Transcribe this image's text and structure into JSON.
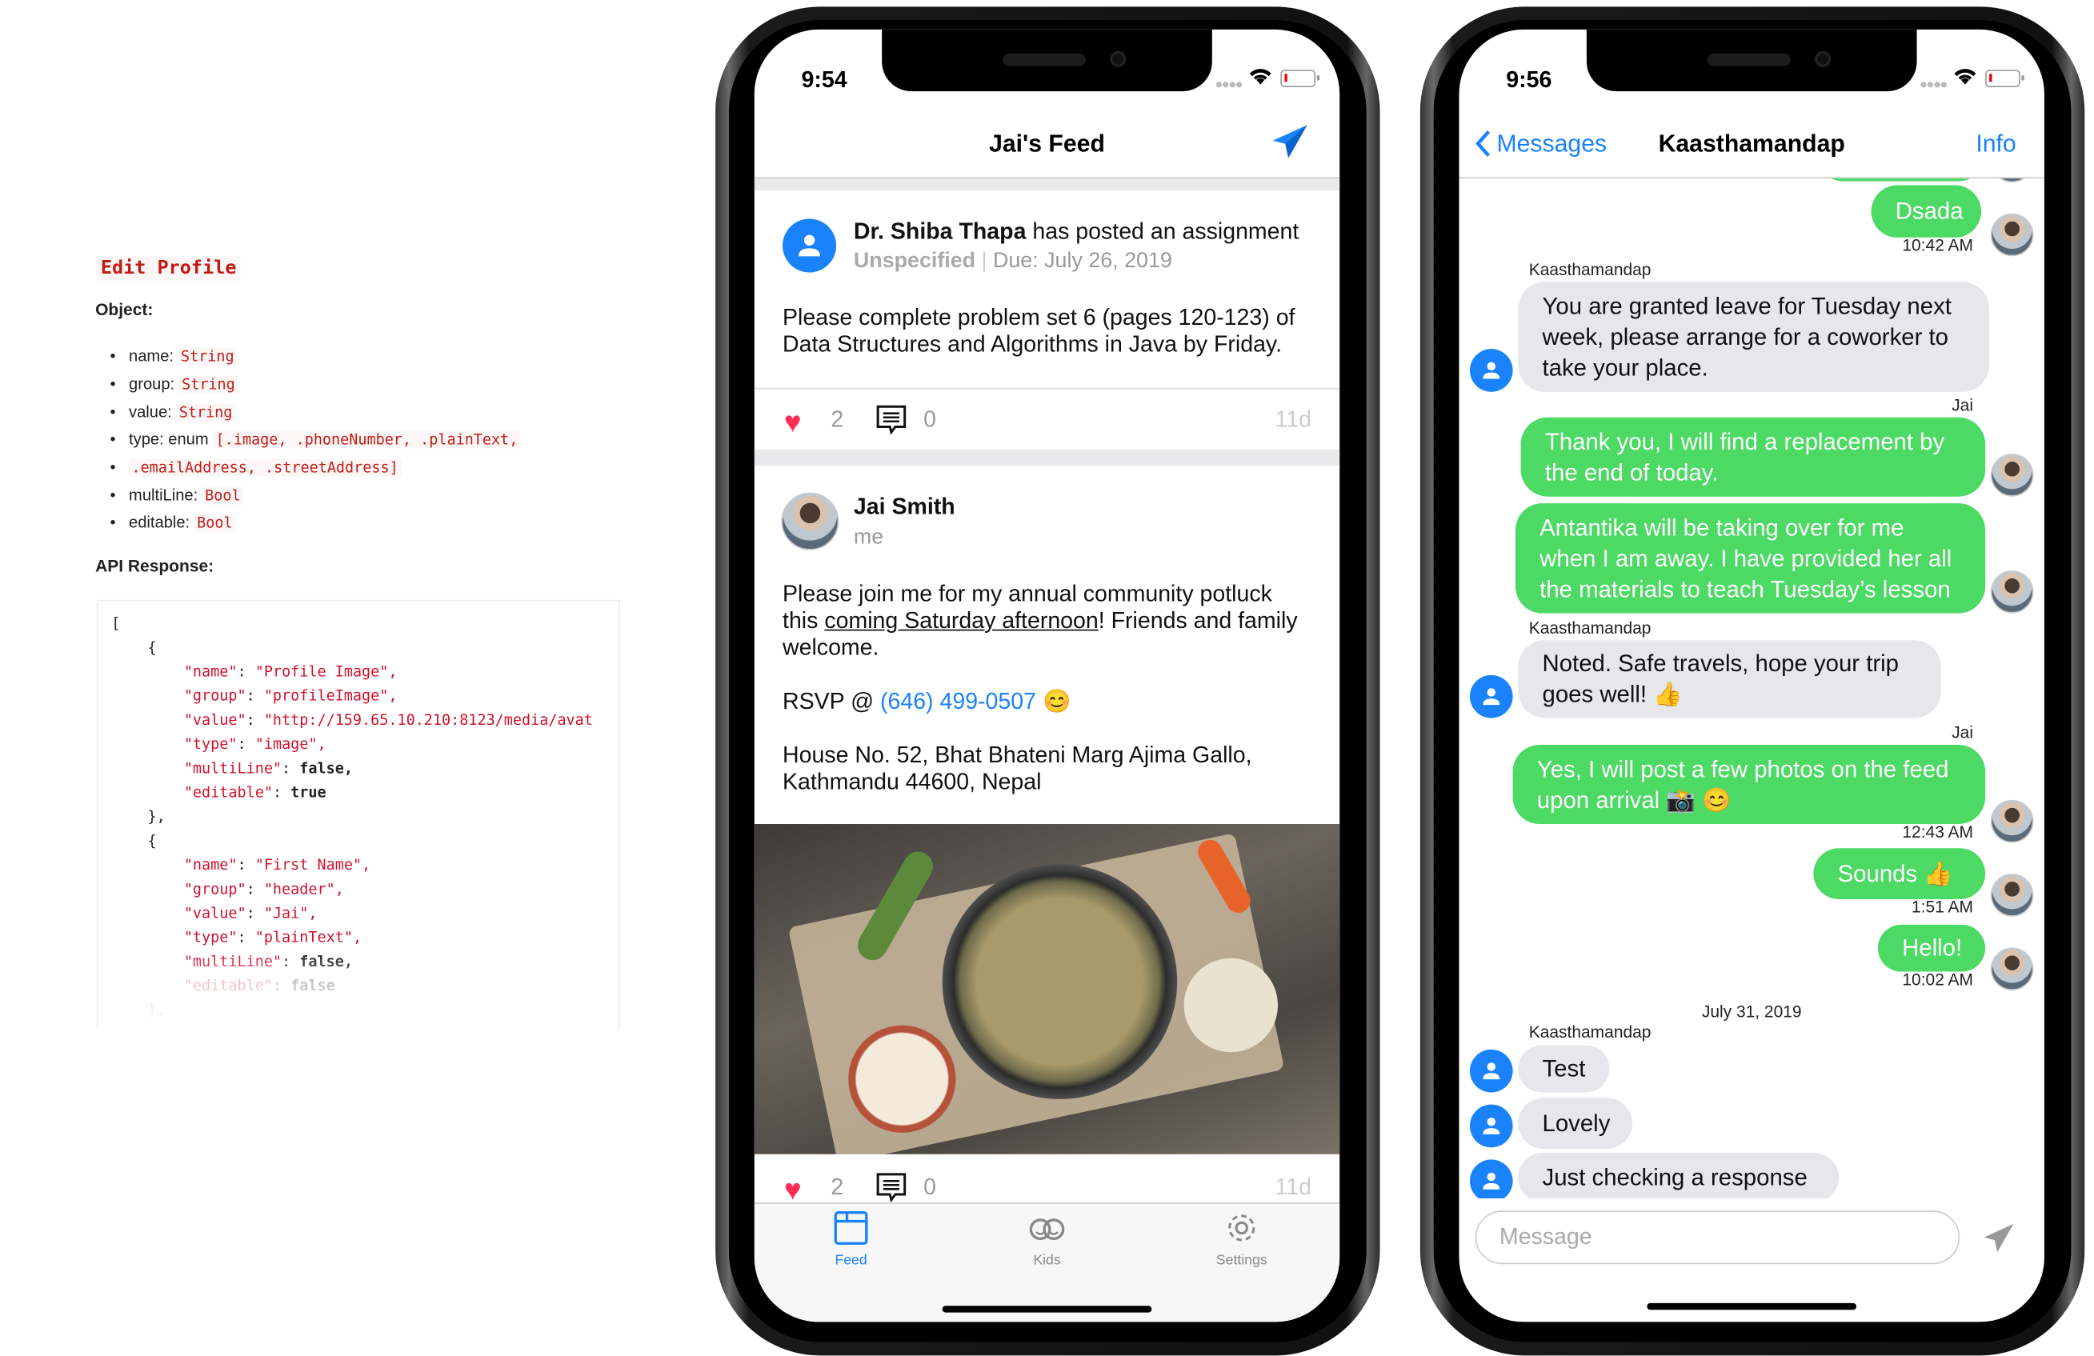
{
  "doc": {
    "title": "Edit Profile",
    "object_heading": "Object:",
    "fields": [
      {
        "label": "name:",
        "type": "String"
      },
      {
        "label": "group:",
        "type": "String"
      },
      {
        "label": "value:",
        "type": "String"
      },
      {
        "label": "type: enum",
        "type": "[.image, .phoneNumber, .plainText,",
        "type_cont": ".emailAddress, .streetAddress]"
      },
      {
        "label": "multiLine:",
        "type": "Bool"
      },
      {
        "label": "editable:",
        "type": "Bool"
      }
    ],
    "api_heading": "API Response:",
    "code": {
      "open_bracket": "[",
      "open_brace": "{",
      "close_brace": "},",
      "items": [
        [
          {
            "k": "\"name\"",
            "v": "\"Profile Image\",",
            "vt": "s"
          },
          {
            "k": "\"group\"",
            "v": "\"profileImage\",",
            "vt": "s"
          },
          {
            "k": "\"value\"",
            "v": "\"http://159.65.10.210:8123/media/avat",
            "vt": "s"
          },
          {
            "k": "\"type\"",
            "v": "\"image\",",
            "vt": "s"
          },
          {
            "k": "\"multiLine\"",
            "v": "false,",
            "vt": "b"
          },
          {
            "k": "\"editable\"",
            "v": "true",
            "vt": "b"
          }
        ],
        [
          {
            "k": "\"name\"",
            "v": "\"First Name\",",
            "vt": "s"
          },
          {
            "k": "\"group\"",
            "v": "\"header\",",
            "vt": "s"
          },
          {
            "k": "\"value\"",
            "v": "\"Jai\",",
            "vt": "s"
          },
          {
            "k": "\"type\"",
            "v": "\"plainText\",",
            "vt": "s"
          },
          {
            "k": "\"multiLine\"",
            "v": "false,",
            "vt": "b"
          },
          {
            "k": "\"editable\"",
            "v": "false",
            "vt": "b"
          }
        ]
      ]
    }
  },
  "feed_phone": {
    "status_time": "9:54",
    "title": "Jai's Feed",
    "post1": {
      "author": "Dr. Shiba Thapa",
      "action": " has posted an assignment",
      "category": "Unspecified",
      "divider": "|",
      "due": "Due: July 26, 2019",
      "body": [
        "Please complete problem set 6 (pages 120-123) of",
        "Data Structures and Algorithms in Java by Friday."
      ],
      "likes": "2",
      "comments": "0",
      "age": "11d"
    },
    "post2": {
      "author": "Jai Smith",
      "subtitle": "me",
      "body_1a": "Please join me for my annual community potluck",
      "body_2a": "this ",
      "body_2link": "coming Saturday afternoon",
      "body_2b": "! Friends and family",
      "body_3": "welcome.",
      "rsvp": "RSVP @ ",
      "phone": "(646) 499-0507",
      "emoji": "😊",
      "address": [
        "House No. 52, Bhat Bhateni Marg Ajima Gallo,",
        "Kathmandu 44600, Nepal"
      ],
      "likes": "2",
      "comments": "0",
      "age": "11d"
    },
    "tabs": [
      {
        "label": "Feed",
        "icon": "feed-icon",
        "active": true
      },
      {
        "label": "Kids",
        "icon": "kids-icon",
        "active": false
      },
      {
        "label": "Settings",
        "icon": "gear-icon",
        "active": false
      }
    ]
  },
  "chat_phone": {
    "status_time": "9:56",
    "back_label": "Messages",
    "title": "Kaasthamandap",
    "info_label": "Info",
    "messages": [
      {
        "text": [
          "Dsada"
        ],
        "time": "10:42 AM"
      },
      {
        "sender": "Kaasthamandap",
        "text": [
          "You are granted leave for Tuesday next",
          "week, please arrange for a coworker to",
          "take your place."
        ]
      },
      {
        "sender": "Jai",
        "text": [
          "Thank you, I will find a replacement by",
          "the end of today."
        ]
      },
      {
        "text": [
          "Antantika will be taking over for me",
          "when I am away. I have provided her all",
          "the materials to teach Tuesday’s lesson"
        ]
      },
      {
        "sender": "Kaasthamandap",
        "text": [
          "Noted. Safe travels, hope your trip",
          "goes well! 👍"
        ]
      },
      {
        "sender": "Jai",
        "text": [
          "Yes, I will post a few photos on the feed",
          "upon arrival 📸 😊"
        ],
        "time": "12:43 AM"
      },
      {
        "text": [
          "Sounds 👍"
        ],
        "time": "1:51 AM"
      },
      {
        "text": [
          "Hello!"
        ],
        "time": "10:02 AM"
      },
      {
        "date": "July 31, 2019"
      },
      {
        "sender": "Kaasthamandap",
        "text": [
          "Test"
        ]
      },
      {
        "text": [
          "Lovely"
        ]
      },
      {
        "text": [
          "Just checking a response"
        ]
      }
    ],
    "input_placeholder": "Message"
  },
  "colors": {
    "accent": "#007aff",
    "sent_bubble": "#4cd964",
    "received_bubble": "#e6e6eb",
    "code_red": "#c41a16",
    "like_red": "#ff2d55"
  }
}
